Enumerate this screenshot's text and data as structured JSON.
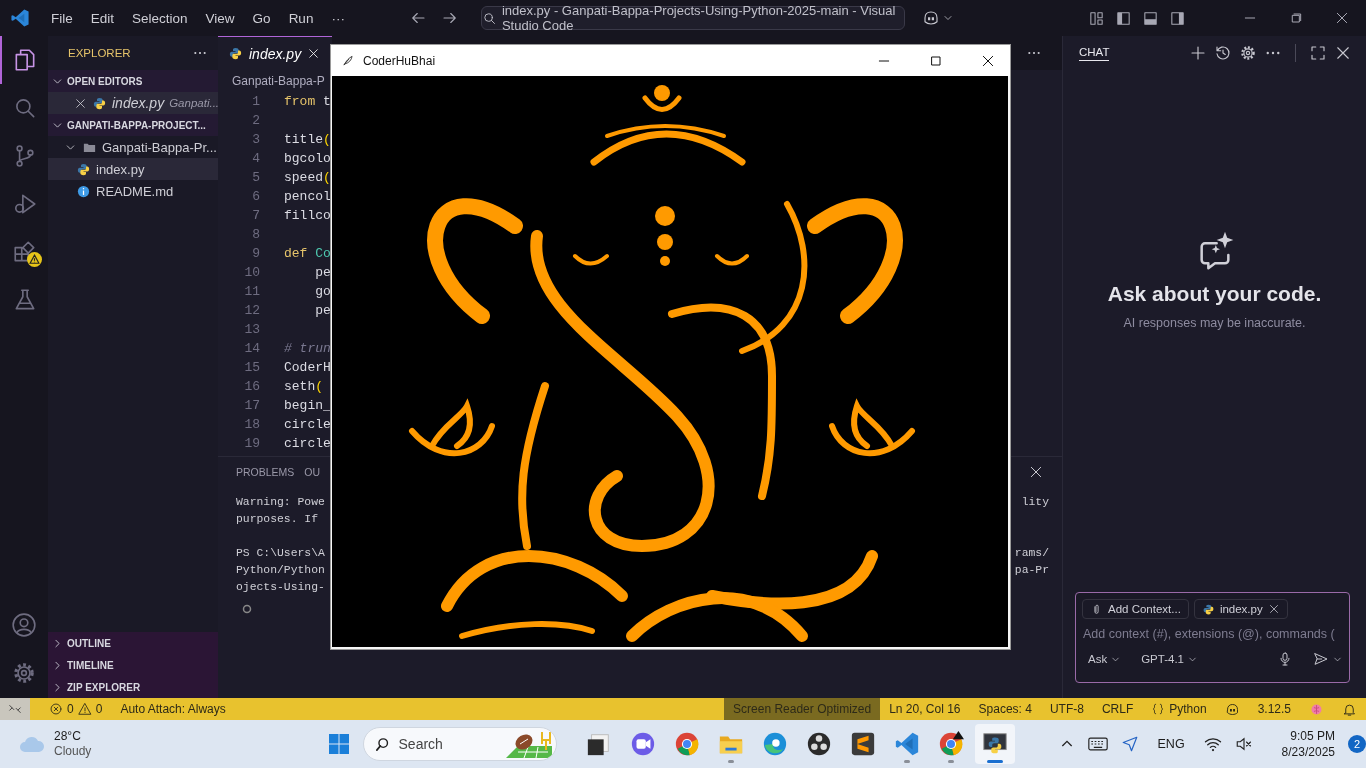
{
  "titlebar": {
    "menus": [
      "File",
      "Edit",
      "Selection",
      "View",
      "Go",
      "Run",
      "···"
    ],
    "command_center": "index.py - Ganpati-Bappa-Projects-Using-Python-2025-main - Visual Studio Code"
  },
  "activity_bar": {
    "items": [
      {
        "kind": "explorer",
        "selected": true,
        "warning": false
      },
      {
        "kind": "search",
        "selected": false,
        "warning": false
      },
      {
        "kind": "source-control",
        "selected": false,
        "warning": false
      },
      {
        "kind": "run",
        "selected": false,
        "warning": false
      },
      {
        "kind": "extensions",
        "selected": false,
        "warning": true
      },
      {
        "kind": "testing",
        "selected": false,
        "warning": false
      }
    ]
  },
  "sidebar": {
    "title": "EXPLORER",
    "sections": [
      {
        "title": "OPEN EDITORS",
        "expanded": true,
        "items": [
          {
            "kind": "python",
            "label": "index.py",
            "description": "Ganpati...",
            "selected": true
          }
        ]
      },
      {
        "title": "GANPATI-BAPPA-PROJECT...",
        "expanded": true,
        "items": [
          {
            "kind": "folder",
            "label": "Ganpati-Bappa-Pr...",
            "expanded": true,
            "selected": false,
            "children": [
              {
                "kind": "python",
                "label": "index.py",
                "selected": true
              },
              {
                "kind": "info",
                "label": "README.md",
                "selected": false
              }
            ]
          }
        ]
      }
    ],
    "bottom_sections": [
      {
        "title": "OUTLINE",
        "expanded": false
      },
      {
        "title": "TIMELINE",
        "expanded": false
      },
      {
        "title": "ZIP EXPLORER",
        "expanded": false
      }
    ]
  },
  "editor": {
    "tab": {
      "label": "index.py",
      "selected": true
    },
    "breadcrumb": "Ganpati-Bappa-P",
    "lines": [
      {
        "number": "1",
        "tokens": [
          {
            "kind": "keyword",
            "text": "from"
          },
          {
            "kind": "plain",
            "text": " t"
          }
        ]
      },
      {
        "number": "2"
      },
      {
        "number": "3",
        "tokens": [
          {
            "kind": "plain",
            "text": "title"
          },
          {
            "kind": "paren",
            "text": "("
          }
        ]
      },
      {
        "number": "4",
        "tokens": [
          {
            "kind": "plain",
            "text": "bgcolo"
          }
        ]
      },
      {
        "number": "5",
        "tokens": [
          {
            "kind": "plain",
            "text": "speed"
          },
          {
            "kind": "paren",
            "text": "("
          }
        ]
      },
      {
        "number": "6",
        "tokens": [
          {
            "kind": "plain",
            "text": "pencol"
          }
        ]
      },
      {
        "number": "7",
        "tokens": [
          {
            "kind": "plain",
            "text": "fillco"
          }
        ]
      },
      {
        "number": "8"
      },
      {
        "number": "9",
        "tokens": [
          {
            "kind": "keyword",
            "text": "def"
          },
          {
            "kind": "name",
            "text": " Co"
          }
        ]
      },
      {
        "number": "10",
        "tokens": [
          {
            "kind": "plain",
            "text": "    pe"
          }
        ]
      },
      {
        "number": "11",
        "tokens": [
          {
            "kind": "plain",
            "text": "    go"
          }
        ]
      },
      {
        "number": "12",
        "tokens": [
          {
            "kind": "plain",
            "text": "    pe"
          }
        ]
      },
      {
        "number": "13"
      },
      {
        "number": "14",
        "tokens": [
          {
            "kind": "comment",
            "text": "# trun"
          }
        ]
      },
      {
        "number": "15",
        "tokens": [
          {
            "kind": "plain",
            "text": "CoderH"
          }
        ]
      },
      {
        "number": "16",
        "tokens": [
          {
            "kind": "plain",
            "text": "seth"
          },
          {
            "kind": "paren",
            "text": "("
          }
        ]
      },
      {
        "number": "17",
        "tokens": [
          {
            "kind": "plain",
            "text": "begin_"
          }
        ]
      },
      {
        "number": "18",
        "tokens": [
          {
            "kind": "plain",
            "text": "circle"
          }
        ]
      },
      {
        "number": "19",
        "tokens": [
          {
            "kind": "plain",
            "text": "circle"
          }
        ]
      }
    ]
  },
  "panel": {
    "tabs": [
      {
        "label": "PROBLEMS",
        "selected": false
      },
      {
        "label": "OU",
        "selected": false
      }
    ],
    "lines": [
      {
        "left": "Warning: Powe",
        "right": "lity"
      },
      {
        "left": "purposes. If"
      },
      {
        "left": "PS C:\\Users\\A",
        "right": "rams/",
        "gap_before": true
      },
      {
        "left": "Python/Python",
        "right": "pa-Pr"
      },
      {
        "left": "ojects-Using-"
      }
    ]
  },
  "chat": {
    "title": "CHAT",
    "heading": "Ask about your code.",
    "subheading": "AI responses may be inaccurate.",
    "chips": [
      {
        "kind": "attach",
        "label": "Add Context..."
      },
      {
        "kind": "file",
        "label": "index.py"
      }
    ],
    "placeholder": "Add context (#), extensions (@), commands (",
    "mode": "Ask",
    "model": "GPT-4.1"
  },
  "status_bar": {
    "errors": "0",
    "warnings": "0",
    "left": [
      "Auto Attach: Always"
    ],
    "right": [
      {
        "kind": "highlight",
        "label": "Screen Reader Optimized"
      },
      {
        "kind": "text",
        "label": "Ln 20, Col 16"
      },
      {
        "kind": "text",
        "label": "Spaces: 4"
      },
      {
        "kind": "text",
        "label": "UTF-8"
      },
      {
        "kind": "text",
        "label": "CRLF"
      },
      {
        "kind": "language",
        "label": "Python"
      },
      {
        "kind": "copilot"
      },
      {
        "kind": "text",
        "label": "3.12.5"
      },
      {
        "kind": "brain"
      },
      {
        "kind": "bell"
      }
    ]
  },
  "taskbar": {
    "weather": {
      "temperature": "28°C",
      "condition": "Cloudy"
    },
    "search": {
      "placeholder": "Search"
    },
    "apps": [
      {
        "kind": "task-view",
        "running": false,
        "selected": false
      },
      {
        "kind": "meet",
        "running": false,
        "selected": false
      },
      {
        "kind": "chrome",
        "running": false,
        "selected": false
      },
      {
        "kind": "files",
        "running": true,
        "selected": false
      },
      {
        "kind": "edge",
        "running": false,
        "selected": false
      },
      {
        "kind": "obs",
        "running": false,
        "selected": false
      },
      {
        "kind": "sublime",
        "running": false,
        "selected": false
      },
      {
        "kind": "vscode",
        "running": true,
        "selected": false
      },
      {
        "kind": "chrome-profile",
        "running": true,
        "selected": false
      },
      {
        "kind": "python",
        "running": true,
        "selected": true
      }
    ],
    "tray": {
      "language": "ENG",
      "time": "9:05 PM",
      "date": "8/23/2025",
      "notifications": "2"
    }
  },
  "turtle_window": {
    "title": "CoderHuBhai"
  }
}
